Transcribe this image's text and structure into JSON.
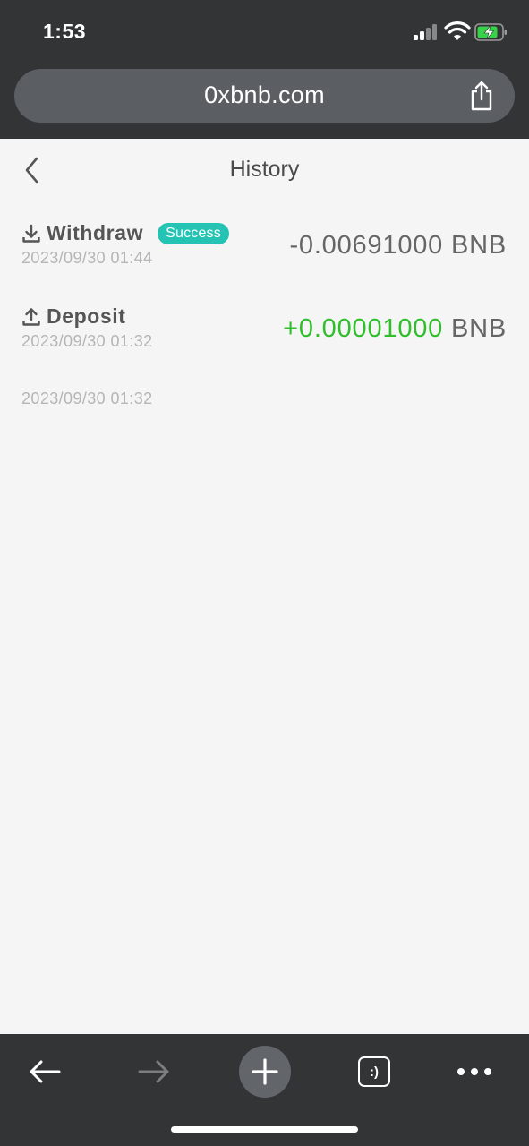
{
  "status_bar": {
    "time": "1:53"
  },
  "browser": {
    "url": "0xbnb.com"
  },
  "page": {
    "title": "History"
  },
  "history": [
    {
      "type": "Withdraw",
      "badge": "Success",
      "date": "2023/09/30 01:44",
      "amount": "-0.00691000",
      "currency": "BNB",
      "direction": "out"
    },
    {
      "type": "Deposit",
      "badge": "",
      "date": "2023/09/30 01:32",
      "amount": "+0.00001000",
      "currency": "BNB",
      "direction": "in"
    }
  ],
  "extra_date": "2023/09/30 01:32",
  "toolbar": {
    "tabs_label": ":)"
  },
  "colors": {
    "chrome": "#333436",
    "badge": "#25c3b3",
    "positive": "#2fbf2a",
    "background": "#f5f5f5"
  }
}
